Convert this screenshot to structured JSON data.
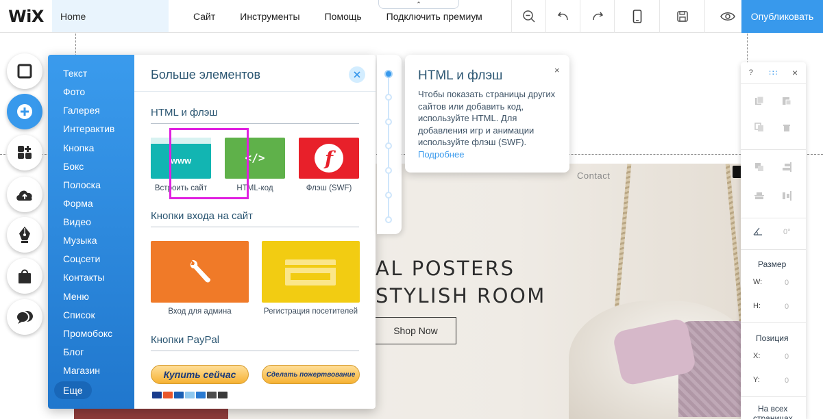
{
  "topbar": {
    "logo": "WiX",
    "page": "Home",
    "menu": [
      "Сайт",
      "Инструменты",
      "Помощь",
      "Подключить премиум"
    ],
    "collapse_glyph": "⌃",
    "tool_icons": [
      "zoom-out-icon",
      "undo-icon",
      "redo-icon",
      "mobile-view-icon",
      "save-icon",
      "preview-icon"
    ],
    "publish": "Опубликовать"
  },
  "left_toolbar": {
    "buttons": [
      "background-icon",
      "add-icon",
      "apps-icon",
      "upload-icon",
      "pen-icon",
      "store-icon",
      "chat-icon"
    ],
    "active": "add-icon"
  },
  "add_panel": {
    "title": "Больше элементов",
    "categories": [
      "Текст",
      "Фото",
      "Галерея",
      "Интерактив",
      "Кнопка",
      "Бокс",
      "Полоска",
      "Форма",
      "Видео",
      "Музыка",
      "Соцсети",
      "Контакты",
      "Меню",
      "Список",
      "Промобокс",
      "Блог",
      "Магазин"
    ],
    "more": "Еще",
    "sections": {
      "html_flash": {
        "title": "HTML и флэш",
        "items": [
          {
            "label": "Встроить сайт",
            "badge": "www",
            "color": "#12b5b2"
          },
          {
            "label": "HTML-код",
            "badge": "</>",
            "color": "#5fb14a"
          },
          {
            "label": "Флэш (SWF)",
            "badge": "f",
            "color": "#e8202a"
          }
        ]
      },
      "login": {
        "title": "Кнопки входа на сайт",
        "items": [
          {
            "label": "Вход для админа",
            "color": "#f07a28"
          },
          {
            "label": "Регистрация посетителей",
            "color": "#f2cc12"
          }
        ]
      },
      "paypal": {
        "title": "Кнопки PayPal",
        "buy": "Купить сейчас",
        "donate": "Сделать пожертвование"
      }
    }
  },
  "tooltip": {
    "title": "HTML и флэш",
    "text": "Чтобы показать страницы других сайтов или добавить код, используйте HTML. Для добавления игр и анимации используйте флэш (SWF).",
    "link": "Подробнее",
    "close": "×"
  },
  "canvas": {
    "contact": "Contact",
    "hero_line1": "AL POSTERS",
    "hero_line2": "STYLISH ROOM",
    "shop_button": "Shop Now"
  },
  "inspector": {
    "help": "?",
    "drag": "∷∷",
    "close": "×",
    "rotation": "0°",
    "size_label": "Размер",
    "w_label": "W:",
    "h_label": "H:",
    "w_value": "0",
    "h_value": "0",
    "position_label": "Позиция",
    "x_label": "X:",
    "y_label": "Y:",
    "x_value": "0",
    "y_value": "0",
    "all_pages": "На всех",
    "all_pages2": "страницах"
  },
  "colors": {
    "accent": "#3899ec",
    "category_bg": "#2a85dc",
    "highlight": "#e020e0"
  }
}
